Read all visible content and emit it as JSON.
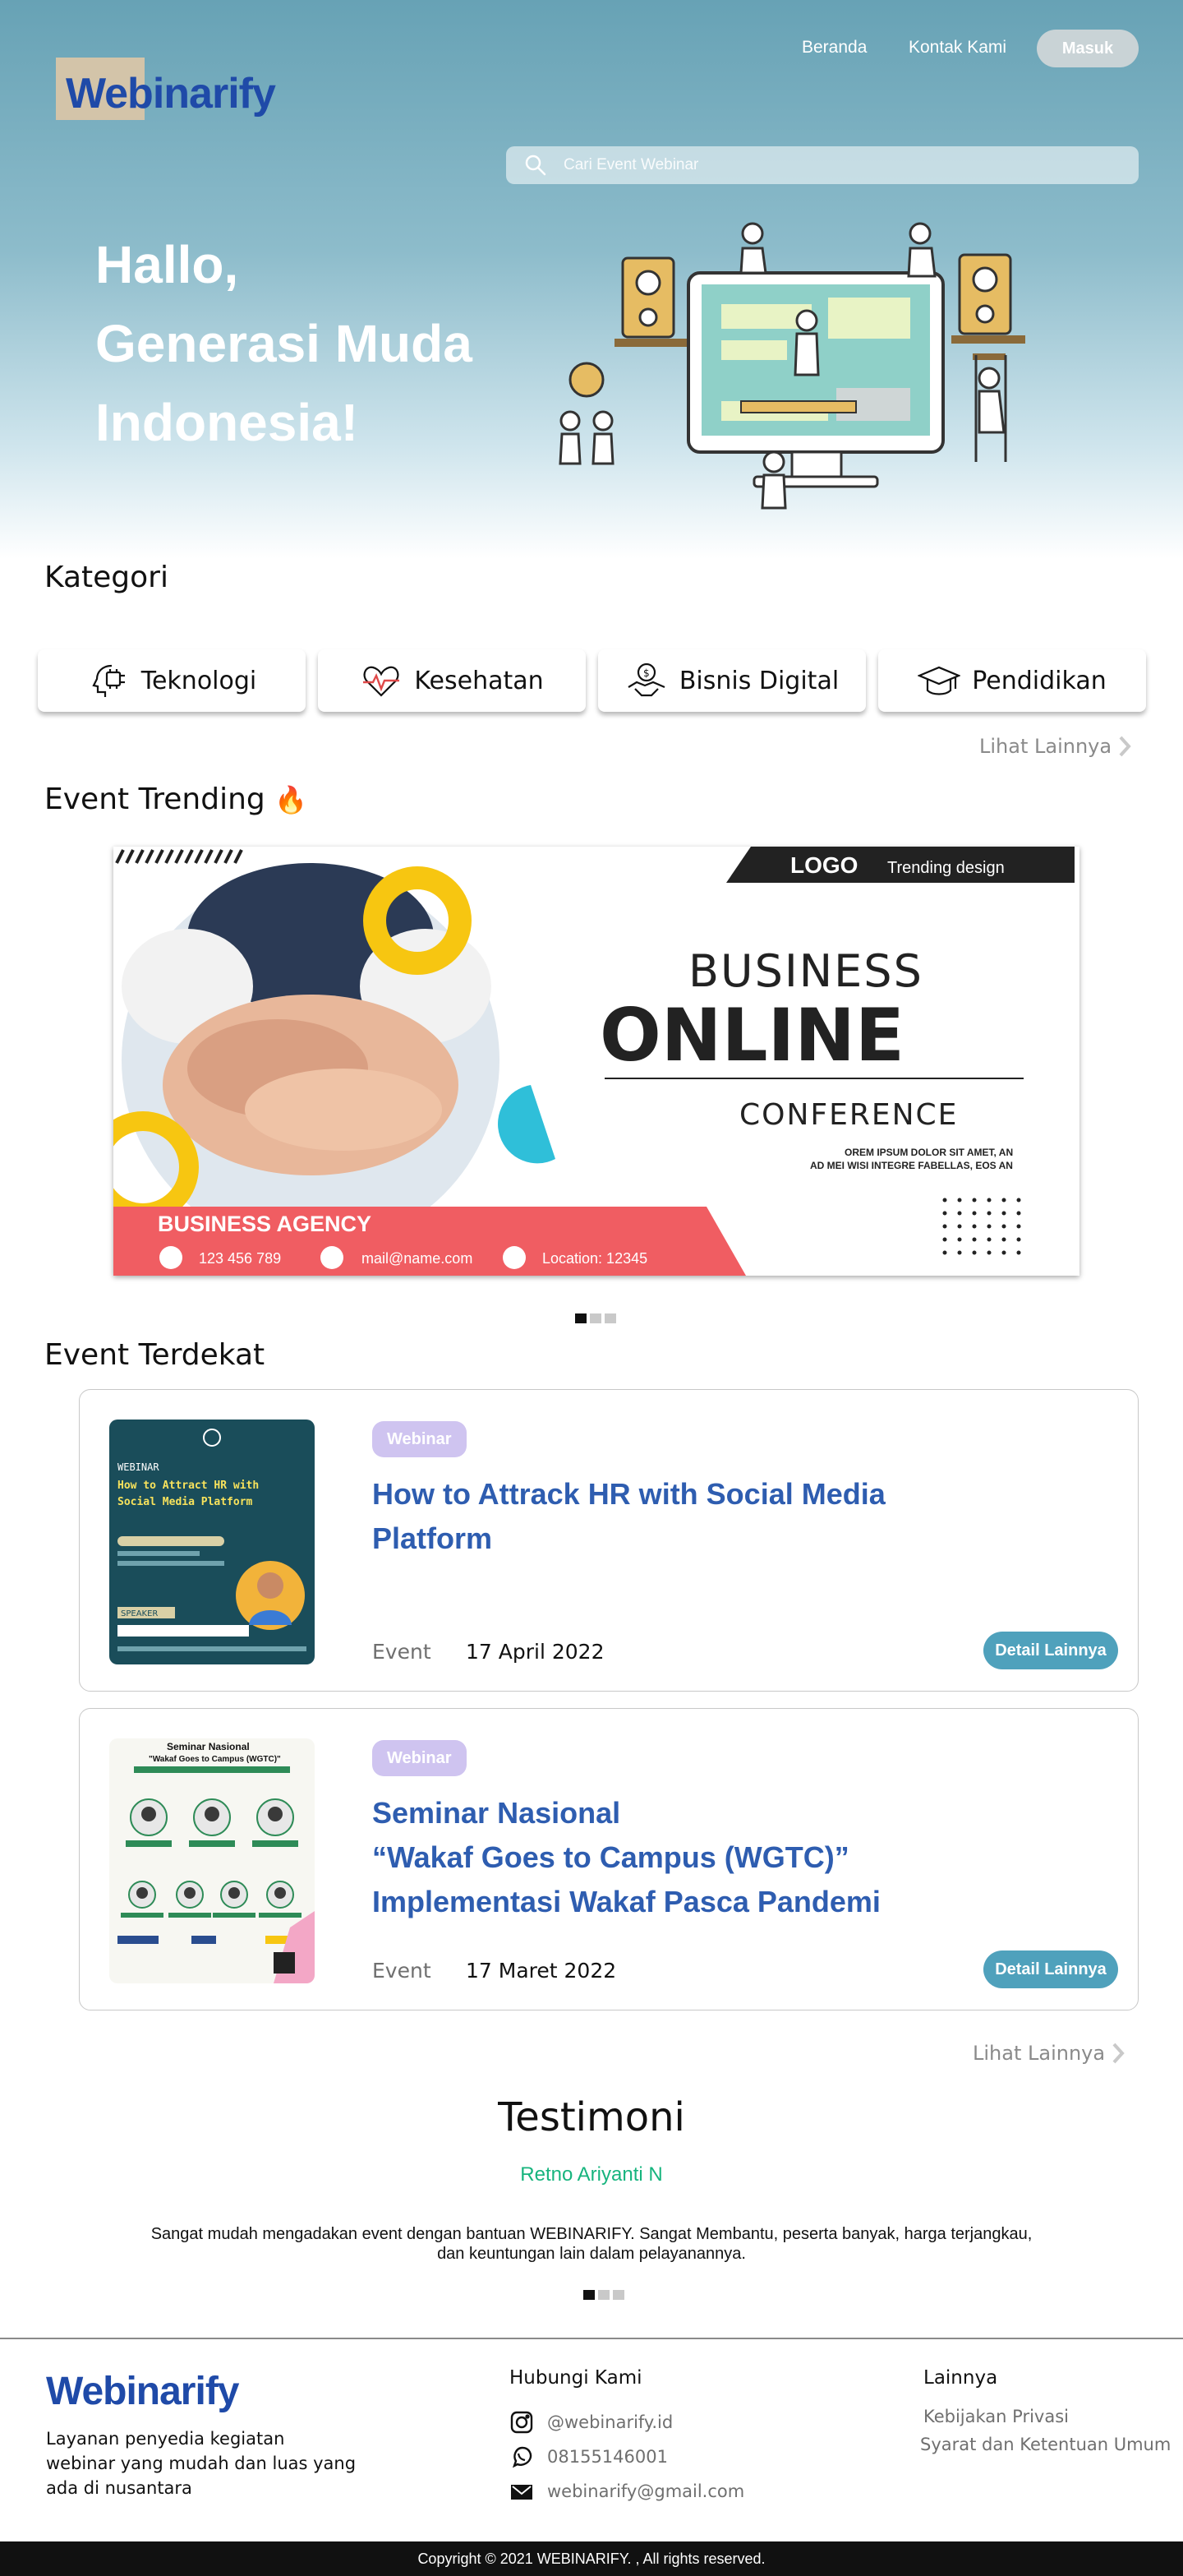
{
  "brand": {
    "logo": "Webinarify",
    "color": "#1f4aa8"
  },
  "nav": {
    "home": "Beranda",
    "contact": "Kontak Kami",
    "login": "Masuk"
  },
  "search": {
    "placeholder": "Cari Event Webinar"
  },
  "hero": {
    "line1": "Hallo,",
    "line2": "Generasi Muda",
    "line3": "Indonesia!"
  },
  "categories": {
    "title": "Kategori",
    "items": [
      {
        "label": "Teknologi",
        "icon": "chip-head-icon"
      },
      {
        "label": "Kesehatan",
        "icon": "heartbeat-icon"
      },
      {
        "label": "Bisnis Digital",
        "icon": "handshake-icon"
      },
      {
        "label": "Pendidikan",
        "icon": "graduation-cap-icon"
      }
    ],
    "see_more": "Lihat Lainnya"
  },
  "trending": {
    "title": "Event Trending",
    "emoji": "🔥",
    "banner": {
      "logo": "LOGO",
      "logo_tag": "Trending design",
      "line1": "BUSINESS",
      "line2": "ONLINE",
      "line3": "CONFERENCE",
      "lorem1": "OREM IPSUM DOLOR SIT AMET, AN",
      "lorem2": "AD MEI WISI INTEGRE FABELLAS, EOS AN",
      "agency": "BUSINESS AGENCY",
      "phone": "123 456 789",
      "email": "mail@name.com",
      "location": "Location: 12345"
    }
  },
  "nearby": {
    "title": "Event Terdekat",
    "events": [
      {
        "badge": "Webinar",
        "title_lines": [
          "How to Attrack HR with Social Media",
          "Platform"
        ],
        "meta_label": "Event",
        "date": "17 April 2022",
        "button": "Detail Lainnya",
        "poster": {
          "head": "WEBINAR",
          "t1": "How to Attract HR with",
          "t2": "Social Media Platform",
          "speaker": "SPEAKER"
        }
      },
      {
        "badge": "Webinar",
        "title_lines": [
          "Seminar Nasional",
          "“Wakaf Goes to Campus (WGTC)”",
          "Implementasi Wakaf Pasca Pandemi"
        ],
        "meta_label": "Event",
        "date": "17 Maret 2022",
        "button": "Detail Lainnya",
        "poster": {
          "t1": "Seminar Nasional",
          "t2": "\"Wakaf Goes to Campus (WGTC)\""
        }
      }
    ],
    "see_more": "Lihat Lainnya"
  },
  "testimonial": {
    "title": "Testimoni",
    "name": "Retno Ariyanti N",
    "text1": "Sangat mudah mengadakan event dengan bantuan WEBINARIFY. Sangat Membantu, peserta banyak, harga terjangkau,",
    "text2": "dan keuntungan lain dalam pelayanannya."
  },
  "footer": {
    "logo": "Webinarify",
    "description": "Layanan penyedia kegiatan webinar yang mudah dan luas yang ada di nusantara",
    "contact_title": "Hubungi Kami",
    "instagram": "@webinarify.id",
    "whatsapp": "08155146001",
    "email": "webinarify@gmail.com",
    "others_title": "Lainnya",
    "privacy": "Kebijakan Privasi",
    "terms": "Syarat dan Ketentuan Umum",
    "copyright": "Copyright © 2021 WEBINARIFY. , All rights reserved."
  },
  "colors": {
    "accent": "#4fa1bc",
    "title_blue": "#2e5db0",
    "badge": "#cfc4f0",
    "testimonial_name": "#17b47e"
  }
}
